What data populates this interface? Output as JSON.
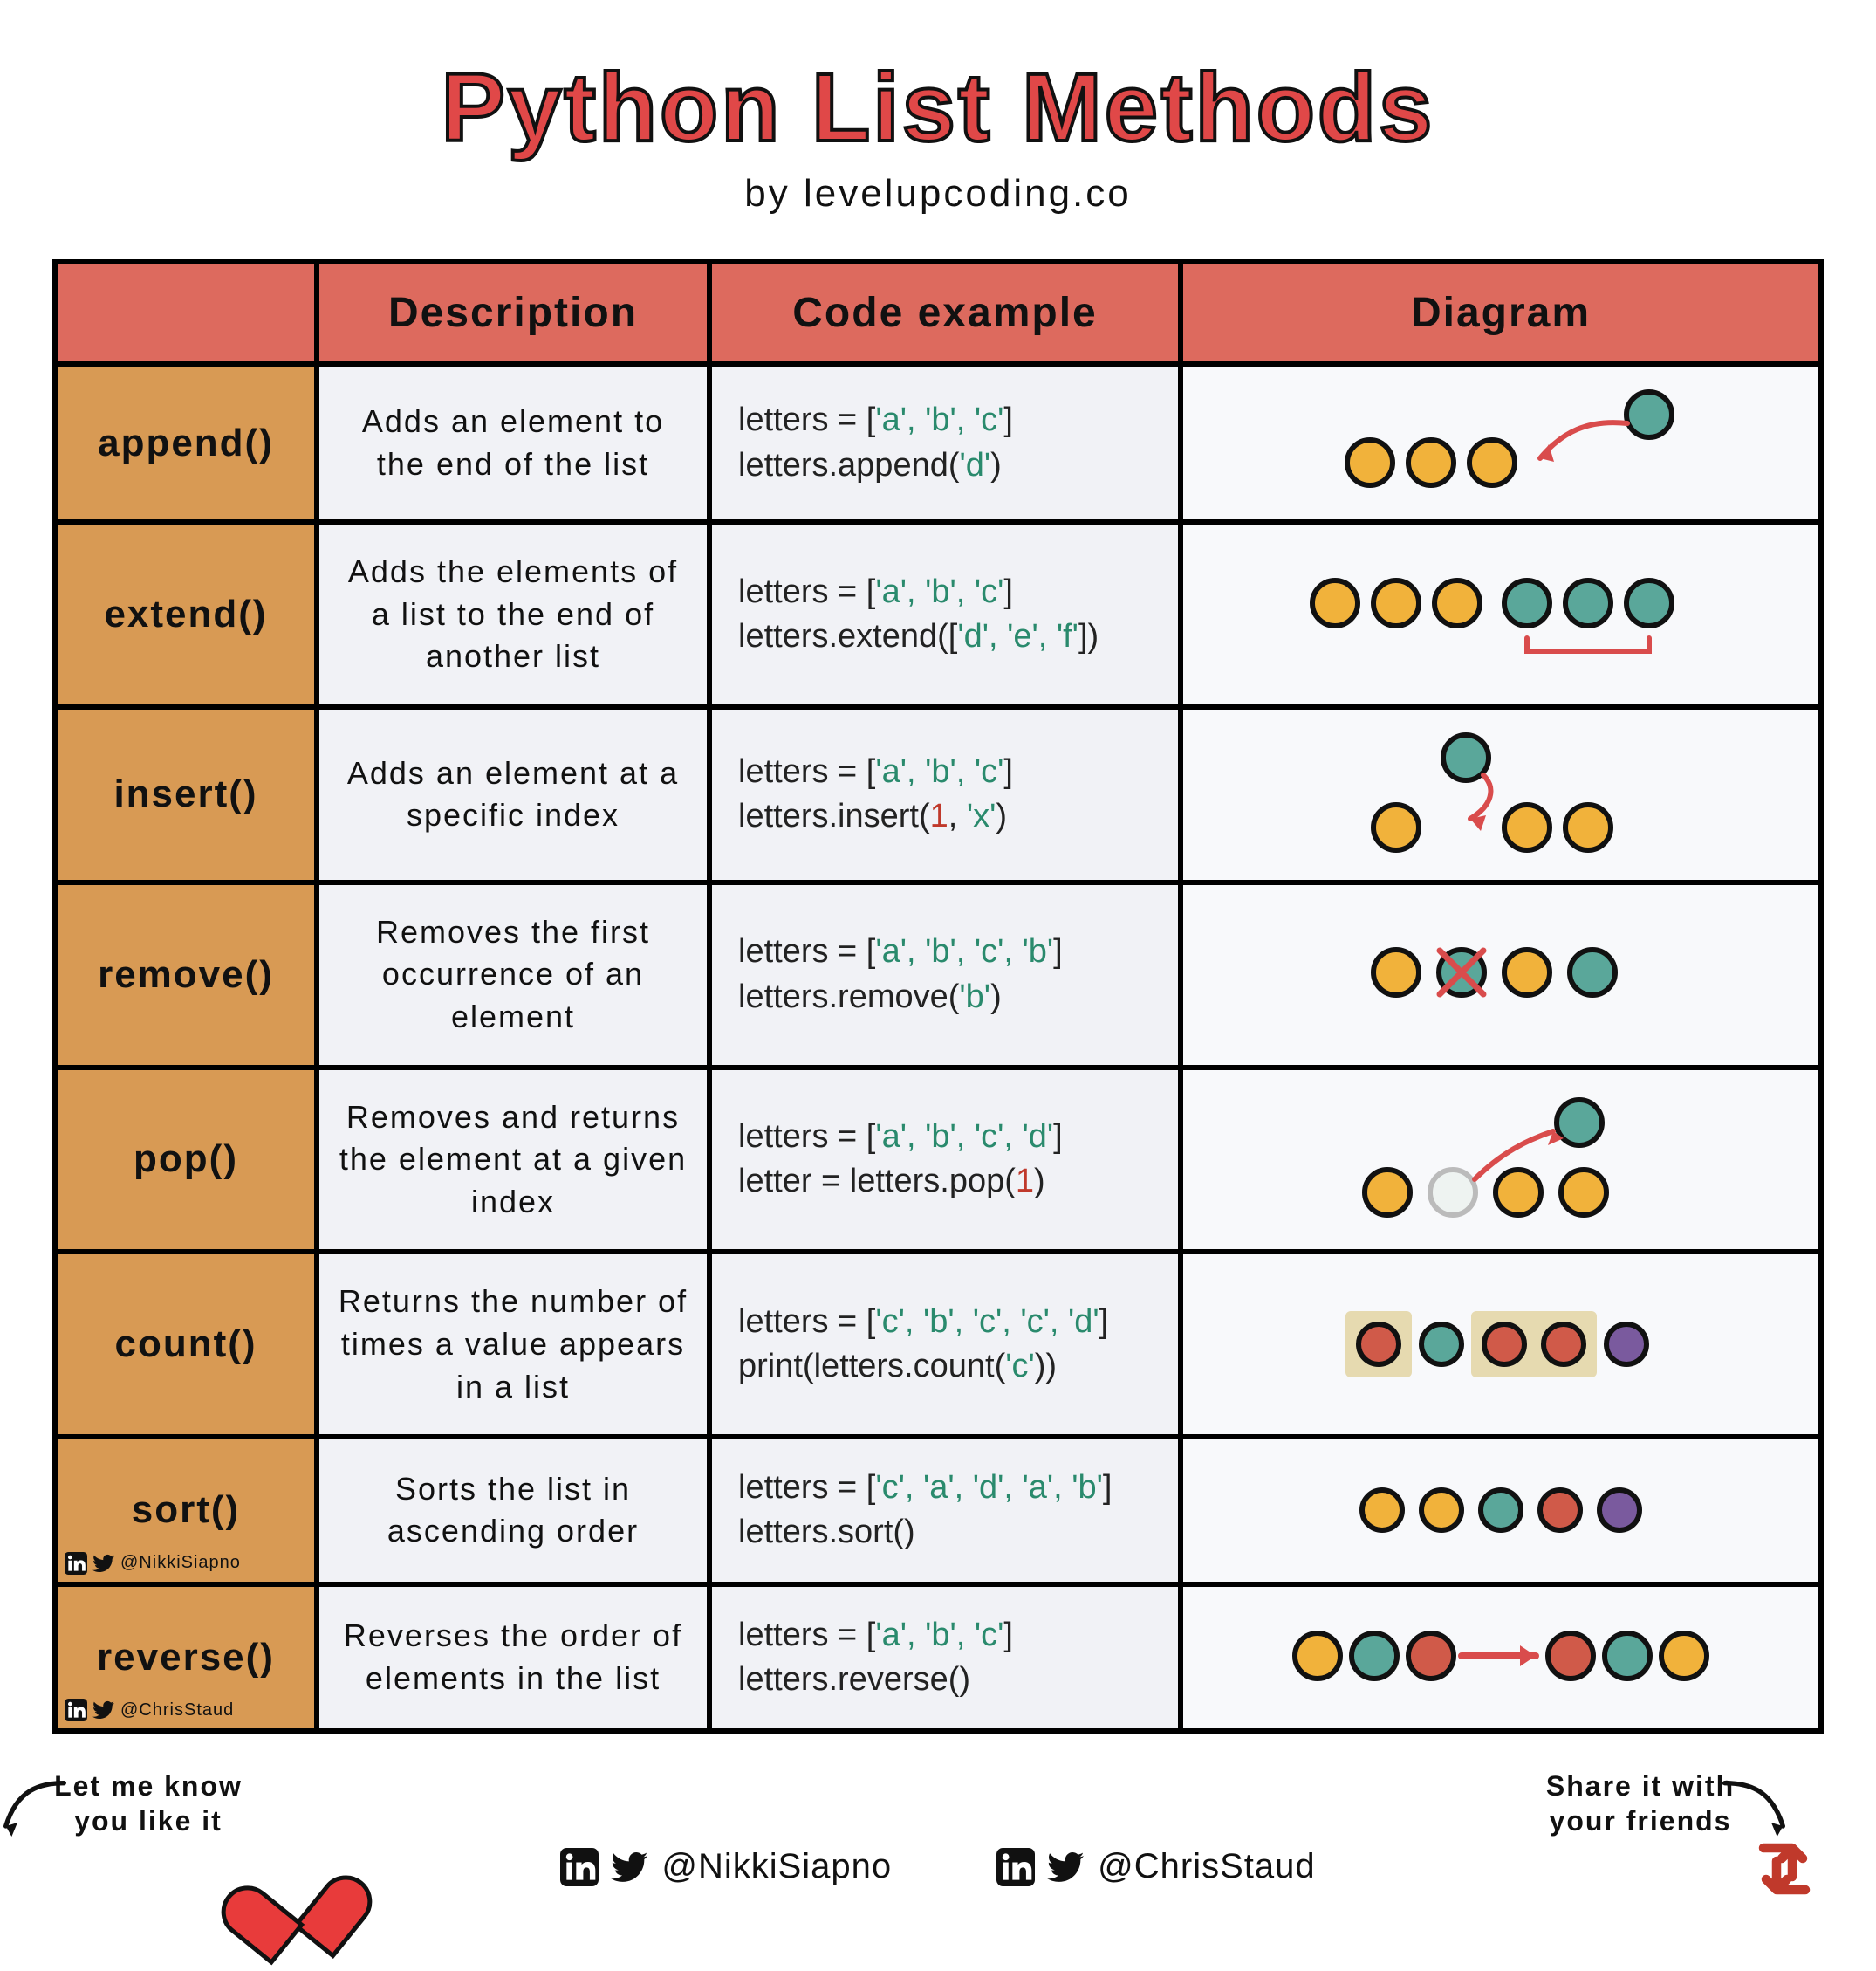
{
  "title": "Python List Methods",
  "byline": "by  levelupcoding.co",
  "headers": {
    "c1": "",
    "c2": "Description",
    "c3": "Code example",
    "c4": "Diagram"
  },
  "rows": [
    {
      "method": "append()",
      "desc": "Adds an element to the end of the list",
      "code_line1_pre": "letters = [",
      "code_line1_args": "'a', 'b', 'c'",
      "code_line1_post": "]",
      "code_line2_pre": "letters.append(",
      "code_line2_args": "'d'",
      "code_line2_post": ")"
    },
    {
      "method": "extend()",
      "desc": "Adds the elements of a list to the end of another list",
      "code_line1_pre": "letters = [",
      "code_line1_args": "'a', 'b', 'c'",
      "code_line1_post": "]",
      "code_line2_pre": "letters.extend([",
      "code_line2_args": "'d', 'e', 'f'",
      "code_line2_post": "])"
    },
    {
      "method": "insert()",
      "desc": "Adds an element at a specific index",
      "code_line1_pre": "letters = [",
      "code_line1_args": "'a', 'b', 'c'",
      "code_line1_post": "]",
      "code_line2_pre": "letters.insert(",
      "code_line2_num": "1",
      "code_line2_mid": ", ",
      "code_line2_args": "'x'",
      "code_line2_post": ")"
    },
    {
      "method": "remove()",
      "desc": "Removes the first occurrence of an element",
      "code_line1_pre": "letters = [",
      "code_line1_args": "'a', 'b', 'c', 'b'",
      "code_line1_post": "]",
      "code_line2_pre": "letters.remove(",
      "code_line2_args": "'b'",
      "code_line2_post": ")"
    },
    {
      "method": "pop()",
      "desc": "Removes and returns the element at a given index",
      "code_line1_pre": "letters = [",
      "code_line1_args": "'a', 'b', 'c', 'd'",
      "code_line1_post": "]",
      "code_line2_pre": "letter = letters.pop(",
      "code_line2_num": "1",
      "code_line2_post": ")"
    },
    {
      "method": "count()",
      "desc": "Returns the number of times a value appears in a list",
      "code_line1_pre": "letters = [",
      "code_line1_args": "'c', 'b', 'c', 'c', 'd'",
      "code_line1_post": "]",
      "code_line2_pre": "print(letters.count(",
      "code_line2_args": "'c'",
      "code_line2_post": "))"
    },
    {
      "method": "sort()",
      "desc": "Sorts the list in ascending order",
      "code_line1_pre": "letters = [",
      "code_line1_args": "'c', 'a', 'd', 'a', 'b'",
      "code_line1_post": "]",
      "code_line2_pre": "letters.sort()",
      "code_line2_args": "",
      "code_line2_post": "",
      "credit": "@NikkiSiapno"
    },
    {
      "method": "reverse()",
      "desc": "Reverses the order of elements in the list",
      "code_line1_pre": "letters = [",
      "code_line1_args": "'a', 'b', 'c'",
      "code_line1_post": "]",
      "code_line2_pre": "letters.reverse()",
      "code_line2_args": "",
      "code_line2_post": "",
      "credit": "@ChrisStaud"
    }
  ],
  "footer": {
    "like_note": "Let me know you like it",
    "share_note": "Share it with your friends",
    "cred1": "@NikkiSiapno",
    "cred2": "@ChrisStaud"
  },
  "colors": {
    "title_red": "#e04848",
    "header_bg": "#dd6a5e",
    "method_bg": "#d89a54",
    "cell_bg": "#f1f2f6",
    "yellow": "#f1b23b",
    "teal": "#5aa79a",
    "red": "#d05a49",
    "purple": "#7a5a9e"
  }
}
